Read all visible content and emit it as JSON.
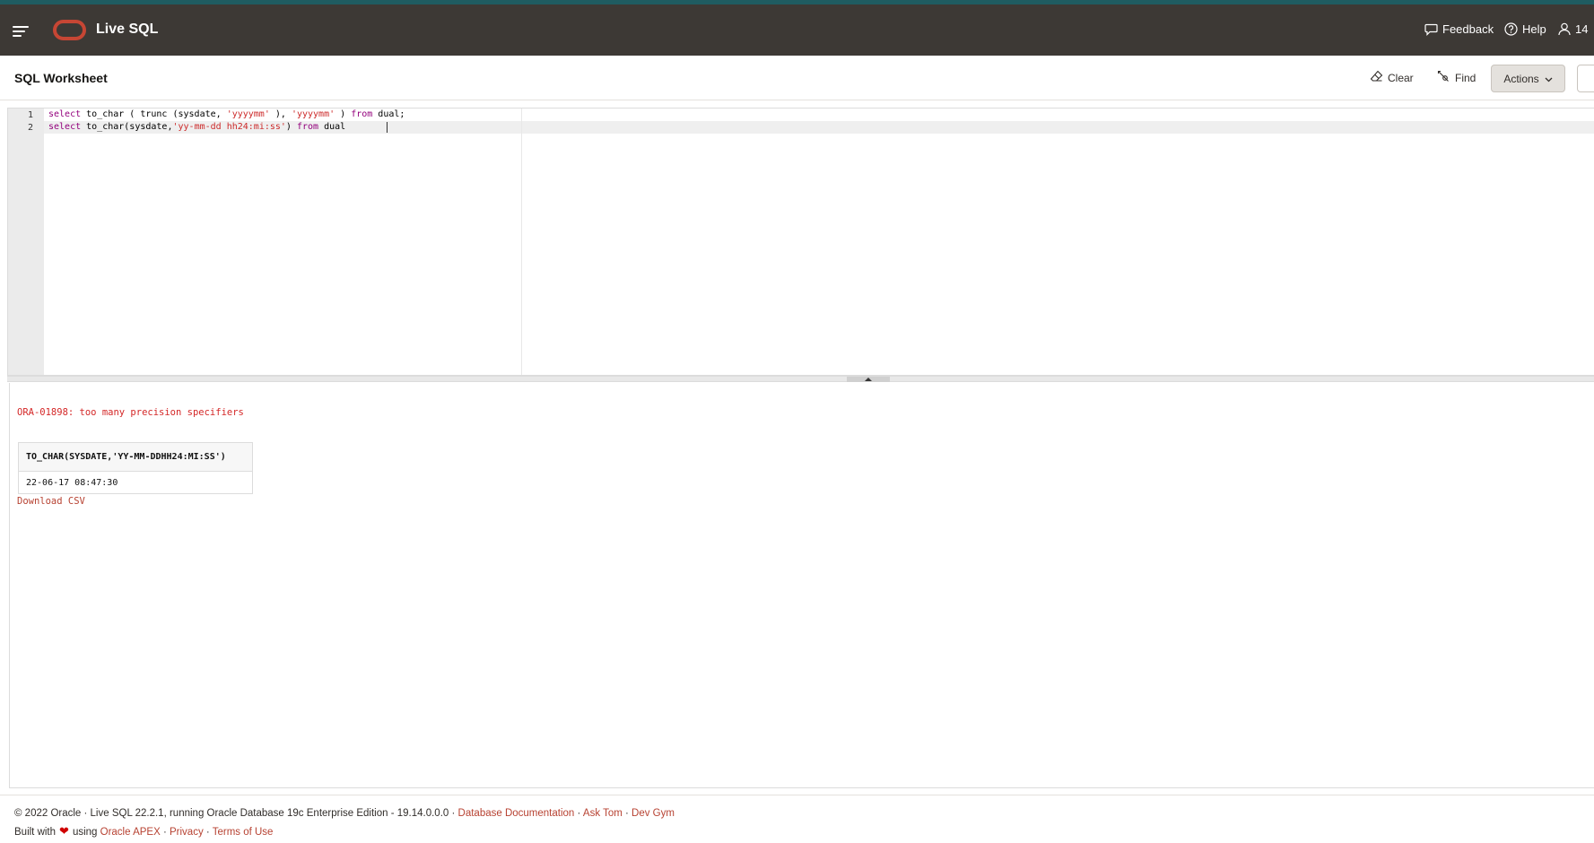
{
  "header": {
    "app_title": "Live SQL",
    "feedback_label": "Feedback",
    "help_label": "Help",
    "user_label": "14"
  },
  "toolbar": {
    "title": "SQL Worksheet",
    "clear_label": "Clear",
    "find_label": "Find",
    "actions_label": "Actions"
  },
  "editor": {
    "lines": [
      {
        "number": "1",
        "tokens": [
          "select",
          " to_char ( trunc (sysdate, ",
          "'yyyymm'",
          " ), ",
          "'yyyymm'",
          " ) ",
          "from",
          " dual;"
        ]
      },
      {
        "number": "2",
        "tokens": [
          "select",
          " to_char(sysdate,",
          "'yy-mm-dd hh24:mi:ss'",
          ") ",
          "from",
          " dual"
        ]
      }
    ]
  },
  "results": {
    "error_message": "ORA-01898: too many precision specifiers",
    "table": {
      "headers": [
        "TO_CHAR(SYSDATE,'YY-MM-DDHH24:MI:SS')"
      ],
      "rows": [
        [
          "22-06-17 08:47:30"
        ]
      ]
    },
    "download_label": "Download CSV"
  },
  "footer": {
    "copyright": "© 2022 Oracle · Live SQL 22.2.1, running Oracle Database 19c Enterprise Edition - 19.14.0.0.0 ·",
    "docs_link": "Database Documentation",
    "sep1": " · ",
    "ask_tom_link": "Ask Tom",
    "sep2": " · ",
    "dev_gym_link": "Dev Gym",
    "built_with": "Built with",
    "using": "using",
    "apex_link": "Oracle APEX",
    "sep3": " · ",
    "privacy_link": "Privacy",
    "sep4": " · ",
    "terms_link": "Terms of Use"
  },
  "colors": {
    "header_bg": "#3d3935",
    "accent_strip": "#1f5c61",
    "oracle_red": "#c74634",
    "link": "#b74232",
    "error": "#d42727"
  },
  "icons": [
    "hamburger-icon",
    "oracle-logo",
    "feedback-icon",
    "help-icon",
    "user-icon",
    "eraser-icon",
    "find-icon",
    "chevron-down-icon",
    "heart-icon"
  ]
}
